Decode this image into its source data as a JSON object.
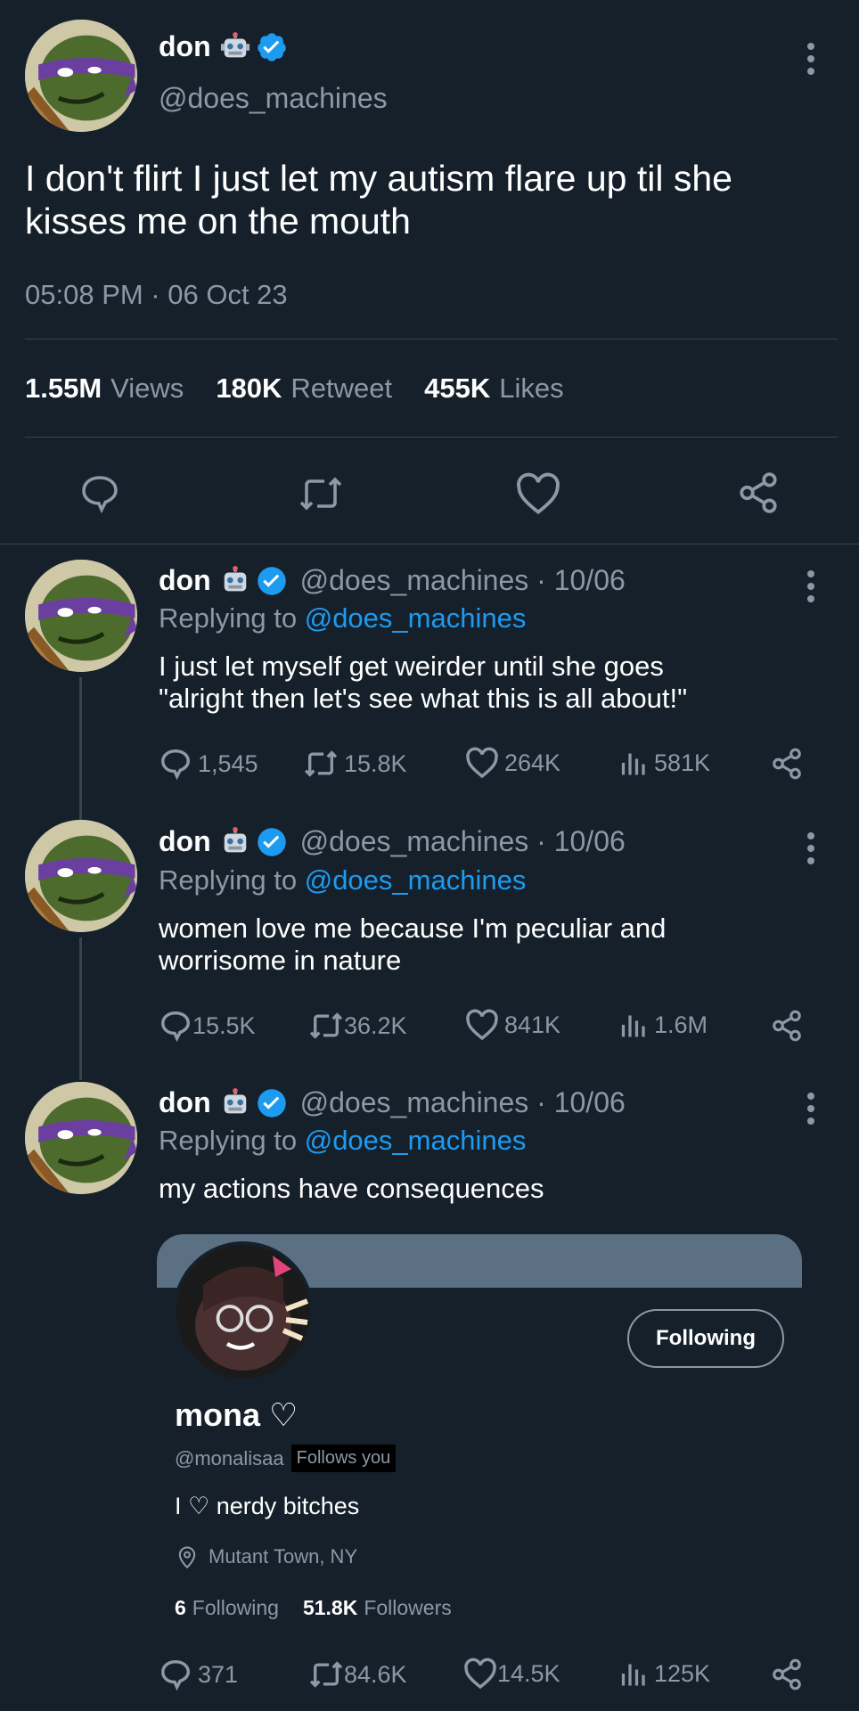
{
  "main_tweet": {
    "name": "don",
    "handle": "@does_machines",
    "text_line1": "I don't flirt I just let my autism flare up til she",
    "text_line2": "kisses me on the mouth",
    "timestamp": "05:08 PM · 06 Oct 23",
    "views_count": "1.55M",
    "views_label": "Views",
    "retweets_count": "180K",
    "retweets_label": "Retweet",
    "likes_count": "455K",
    "likes_label": "Likes"
  },
  "replies": [
    {
      "name": "don",
      "handle_date": "@does_machines · 10/06",
      "replying_prefix": "Replying to",
      "replying_handle": "@does_machines",
      "text_line1": "I just let myself get weirder until she goes",
      "text_line2": "\"alright then let's see what this is all about!\"",
      "replies": "1,545",
      "retweets": "15.8K",
      "likes": "264K",
      "views": "581K"
    },
    {
      "name": "don",
      "handle_date": "@does_machines · 10/06",
      "replying_prefix": "Replying to",
      "replying_handle": "@does_machines",
      "text_line1": "women love me because I'm peculiar and",
      "text_line2": "worrisome in nature",
      "replies": "15.5K",
      "retweets": "36.2K",
      "likes": "841K",
      "views": "1.6M"
    },
    {
      "name": "don",
      "handle_date": "@does_machines · 10/06",
      "replying_prefix": "Replying to",
      "replying_handle": "@does_machines",
      "text_line1": "my actions have consequences",
      "replies": "371",
      "retweets": "84.6K",
      "likes": "14.5K",
      "views": "125K"
    }
  ],
  "profile_card": {
    "name": "mona ♡",
    "handle": "@monalisaa",
    "follows_you": "Follows you",
    "follow_button": "Following",
    "bio": "I ♡ nerdy bitches",
    "location": "Mutant Town, NY",
    "following_count": "6",
    "following_label": "Following",
    "followers_count": "51.8K",
    "followers_label": "Followers"
  },
  "icons": {
    "reply": "reply-icon",
    "retweet": "retweet-icon",
    "like": "heart-icon",
    "views": "views-icon",
    "share": "share-icon",
    "verified": "verified-badge-icon",
    "robot": "robot-emoji-icon",
    "more": "more-options-icon",
    "location": "location-pin-icon"
  },
  "colors": {
    "background": "#15202b",
    "accent": "#1d9bf0",
    "muted": "#8b98a5",
    "divider": "#38444d"
  }
}
